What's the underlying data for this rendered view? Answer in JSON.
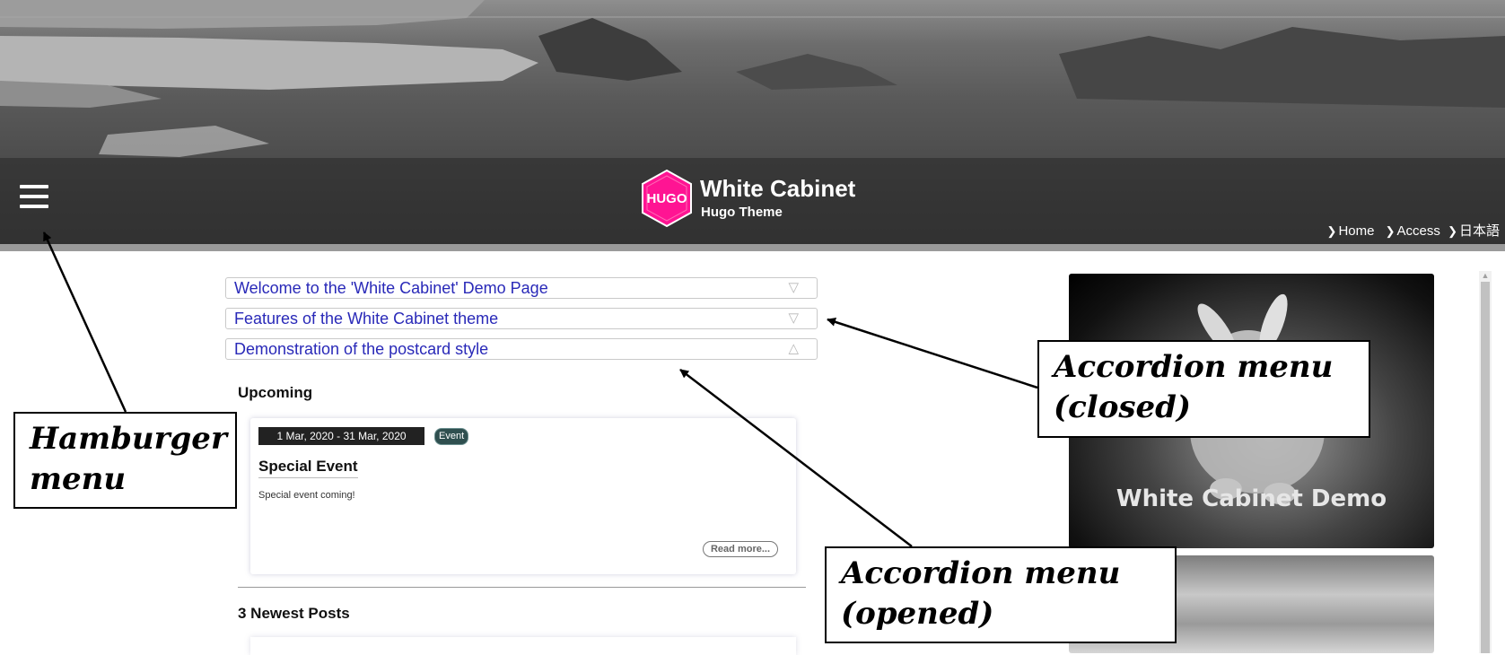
{
  "header": {
    "title": "White Cabinet",
    "subtitle": "Hugo Theme",
    "logo_text": "HUGO",
    "logo_color": "#ff1493",
    "nav": [
      {
        "label": "Home"
      },
      {
        "label": "Access"
      },
      {
        "label": "日本語"
      }
    ]
  },
  "accordion": [
    {
      "label": "Welcome to the 'White Cabinet' Demo Page",
      "arrow": "▽",
      "state": "closed"
    },
    {
      "label": "Features of the White Cabinet theme",
      "arrow": "▽",
      "state": "closed"
    },
    {
      "label": "Demonstration of the postcard style",
      "arrow": "△",
      "state": "opened"
    }
  ],
  "upcoming": {
    "heading": "Upcoming",
    "card": {
      "date": "1 Mar, 2020 - 31 Mar, 2020",
      "tag": "Event",
      "title": "Special Event",
      "text": "Special event coming!",
      "read_more": "Read more..."
    }
  },
  "newest": {
    "heading": "3 Newest Posts"
  },
  "sidebar": {
    "image_caption": "White Cabinet Demo"
  },
  "annotations": {
    "hamburger": [
      "Hamburger",
      "menu"
    ],
    "accordion_closed": [
      "Accordion menu",
      "(closed)"
    ],
    "accordion_opened": [
      "Accordion menu",
      "(opened)"
    ]
  }
}
